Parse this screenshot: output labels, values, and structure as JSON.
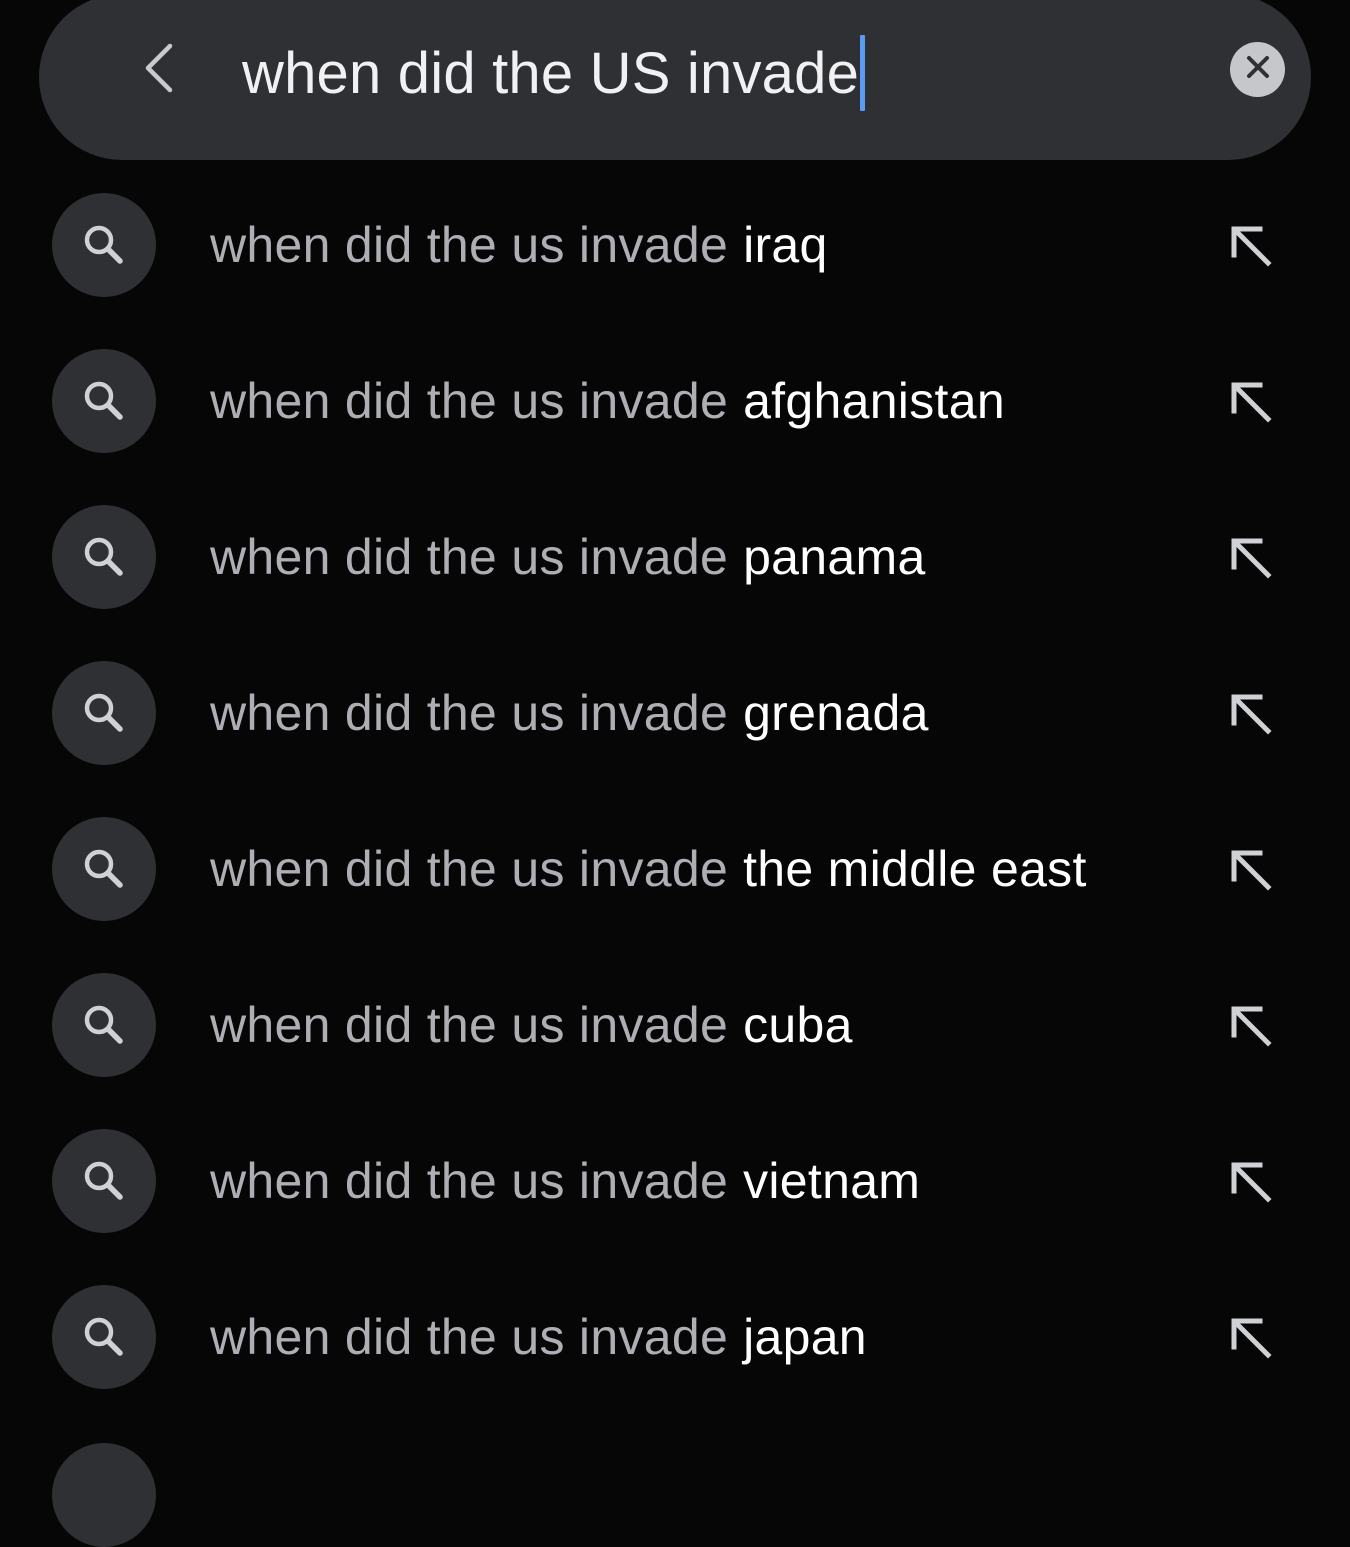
{
  "search": {
    "query": "when did the US invade",
    "back_icon": "chevron-left-icon",
    "clear_icon": "close-icon"
  },
  "suggestions": [
    {
      "prefix": "when did the us invade",
      "completion": "iraq"
    },
    {
      "prefix": "when did the us invade",
      "completion": "afghanistan"
    },
    {
      "prefix": "when did the us invade",
      "completion": "panama"
    },
    {
      "prefix": "when did the us invade",
      "completion": "grenada"
    },
    {
      "prefix": "when did the us invade",
      "completion": "the middle east"
    },
    {
      "prefix": "when did the us invade",
      "completion": "cuba"
    },
    {
      "prefix": "when did the us invade",
      "completion": "vietnam"
    },
    {
      "prefix": "when did the us invade",
      "completion": "japan"
    }
  ],
  "icons": {
    "suggestion": "search-icon",
    "fill_query": "arrow-up-left-icon"
  },
  "colors": {
    "background": "#060607",
    "surface": "#2f3033",
    "caret": "#5a9cf2",
    "prefix_text": "#aeafb4",
    "completion_text": "#ffffff"
  }
}
